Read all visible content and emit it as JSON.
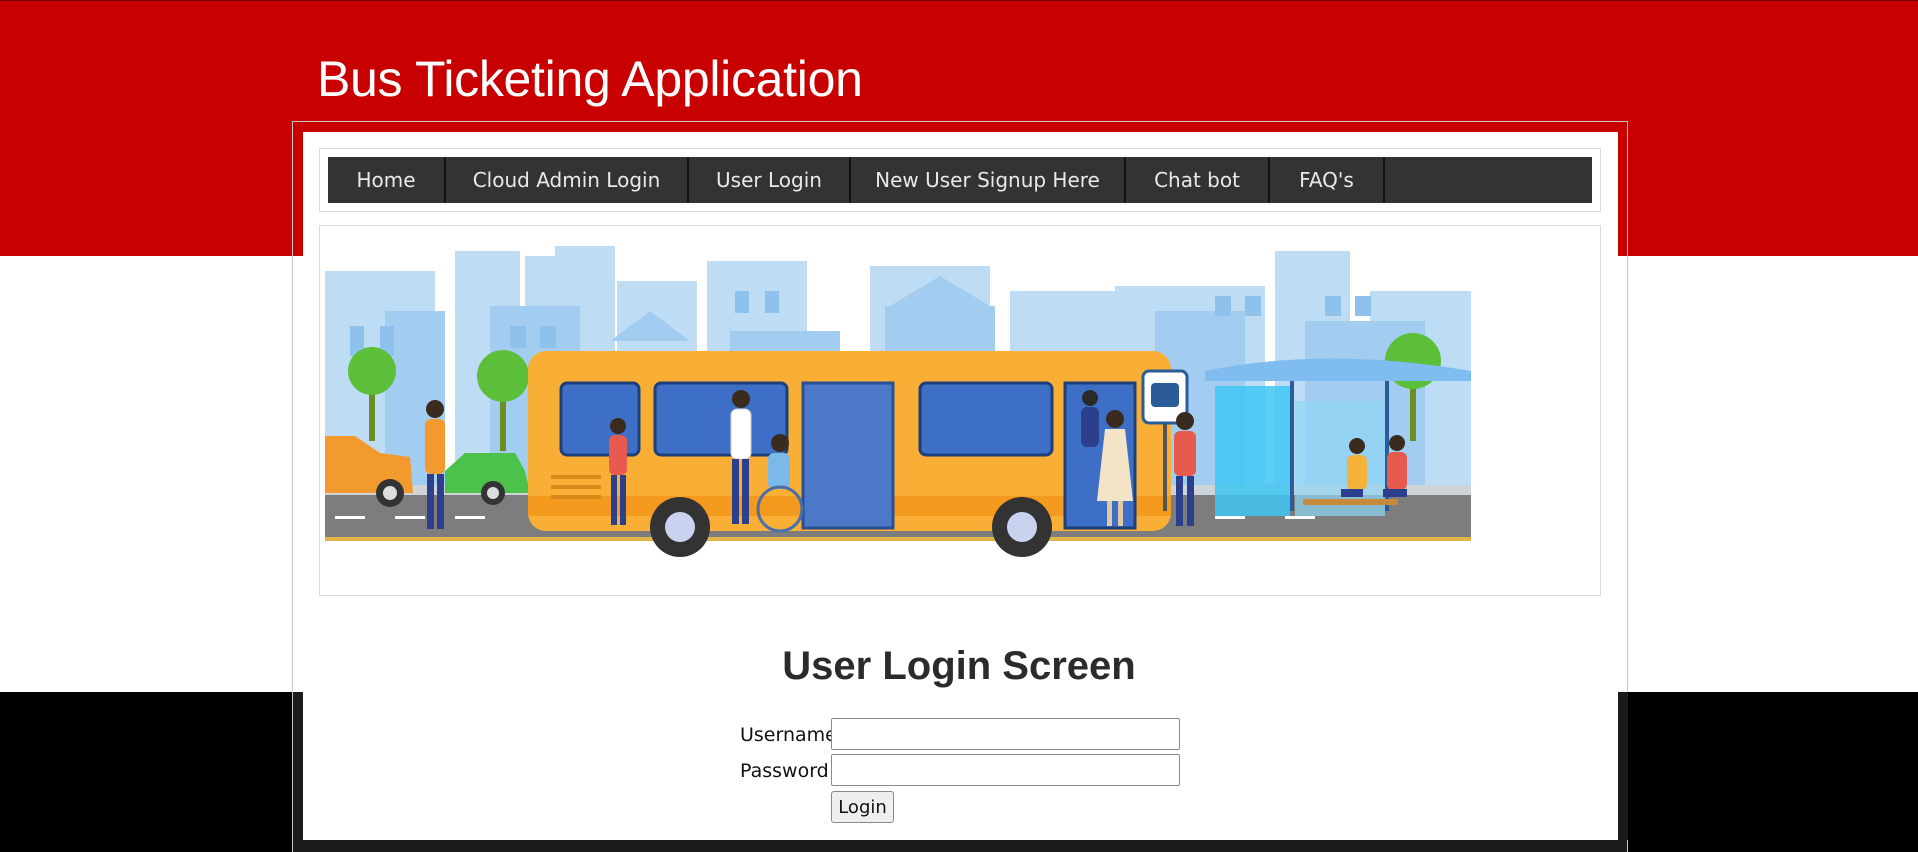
{
  "app": {
    "title": "Bus Ticketing Application"
  },
  "nav": {
    "items": [
      {
        "label": "Home"
      },
      {
        "label": "Cloud Admin Login"
      },
      {
        "label": "User Login"
      },
      {
        "label": "New User Signup Here"
      },
      {
        "label": "Chat bot"
      },
      {
        "label": "FAQ's"
      }
    ]
  },
  "banner": {
    "illustration": "bus-stop-city-illustration"
  },
  "login": {
    "heading": "User Login Screen",
    "username_label": "Username",
    "username_value": "",
    "password_label": "Password",
    "password_value": "",
    "submit_label": "Login"
  },
  "colors": {
    "header_red": "#c80000",
    "nav_bg": "#333333",
    "footer_black": "#000000"
  }
}
